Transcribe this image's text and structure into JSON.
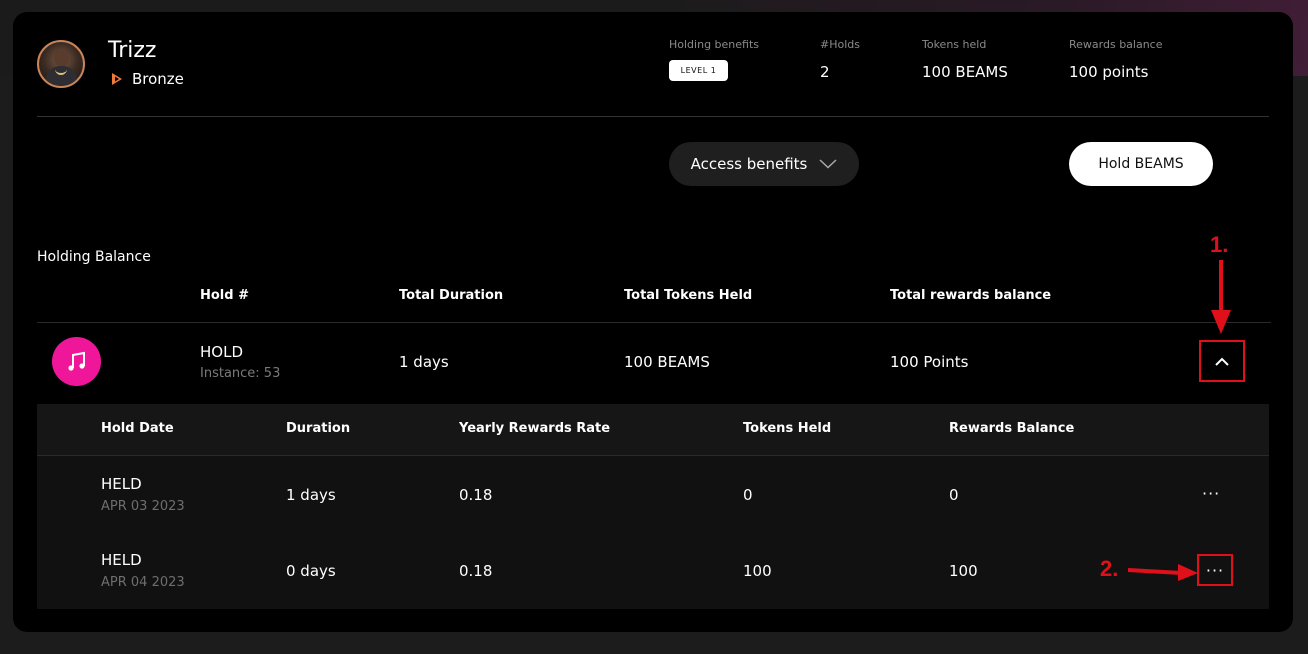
{
  "profile": {
    "name": "Trizz",
    "tier": "Bronze"
  },
  "stats": {
    "holding_benefits_label": "Holding benefits",
    "holding_benefits_value": "LEVEL 1",
    "holds_label": "#Holds",
    "holds_value": "2",
    "tokens_label": "Tokens held",
    "tokens_value": "100 BEAMS",
    "rewards_label": "Rewards balance",
    "rewards_value": "100 points"
  },
  "actions": {
    "access_label": "Access benefits",
    "hold_label": "Hold BEAMS"
  },
  "holding": {
    "title": "Holding Balance",
    "columns": [
      "Hold #",
      "Total Duration",
      "Total Tokens Held",
      "Total rewards balance"
    ],
    "row": {
      "name": "HOLD",
      "instance": "Instance: 53",
      "duration": "1 days",
      "tokens": "100 BEAMS",
      "rewards": "100 Points"
    }
  },
  "details": {
    "columns": [
      "Hold Date",
      "Duration",
      "Yearly Rewards Rate",
      "Tokens Held",
      "Rewards Balance"
    ],
    "rows": [
      {
        "status": "HELD",
        "date": "APR 03 2023",
        "duration": "1 days",
        "rate": "0.18",
        "tokens": "0",
        "rewards": "0"
      },
      {
        "status": "HELD",
        "date": "APR 04 2023",
        "duration": "0 days",
        "rate": "0.18",
        "tokens": "100",
        "rewards": "100"
      }
    ],
    "more_glyph": "···"
  },
  "annotations": {
    "step1": "1.",
    "step2": "2."
  },
  "colors": {
    "accent_pink": "#f0169a",
    "tier_orange": "#f07a3a",
    "annotation_red": "#e0101a"
  }
}
